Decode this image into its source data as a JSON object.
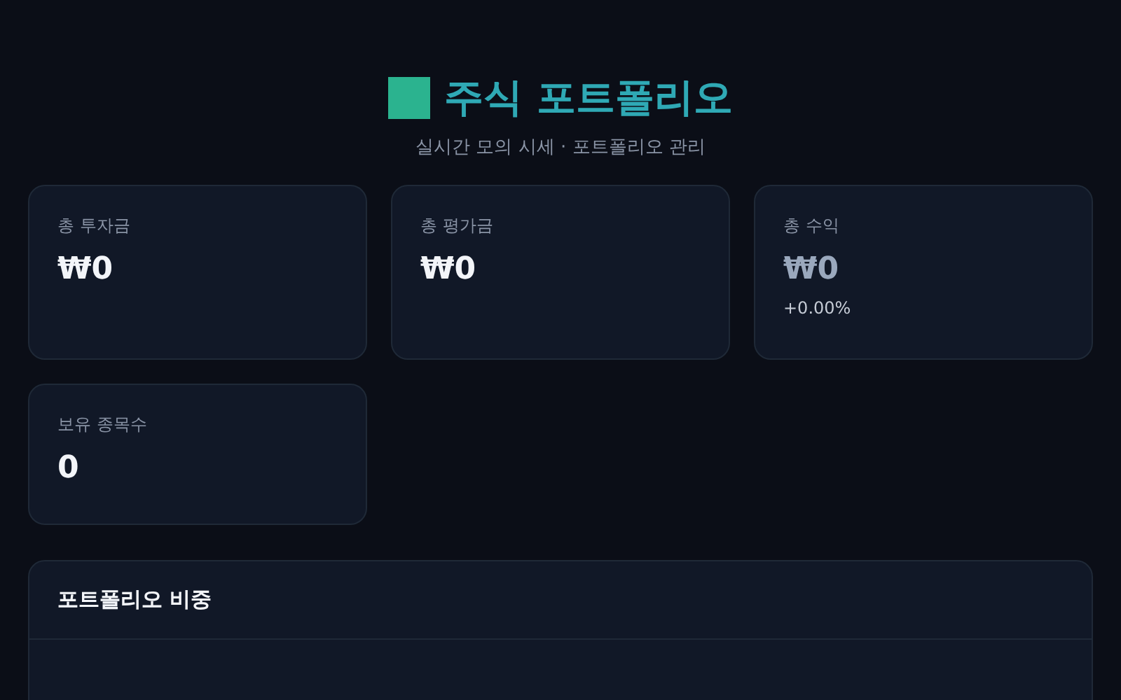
{
  "header": {
    "title": "주식 포트폴리오",
    "subtitle": "실시간 모의 시세 · 포트폴리오 관리"
  },
  "cards": [
    {
      "label": "총 투자금",
      "value": "₩0",
      "color": "#f3f5f9"
    },
    {
      "label": "총 평가금",
      "value": "₩0",
      "color": "#f3f5f9"
    },
    {
      "label": "총 수익",
      "value": "₩0",
      "color": "#9aa8bd",
      "change": "+0.00%"
    },
    {
      "label": "보유 종목수",
      "value": "0",
      "color": "#f3f5f9"
    }
  ],
  "panel": {
    "title": "포트폴리오 비중"
  }
}
